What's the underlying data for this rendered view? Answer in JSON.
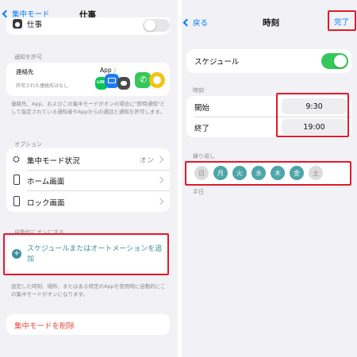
{
  "left": {
    "nav": {
      "back_label": "集中モード",
      "title": "仕事"
    },
    "top_row_label": "仕事",
    "notifications": {
      "section_caption": "通知を許可",
      "people_label": "連絡先",
      "people_sub": "許可された連絡先はなし",
      "apps_label": "App",
      "footnote": "連絡先、App、およびこの集中モードがオンの場合に\"即時通知\"として指定されている通知者やAppからの通話と通知を許可します。"
    },
    "options": {
      "section_caption": "オプション",
      "items": [
        {
          "label": "集中モード状況",
          "value": "オン"
        },
        {
          "label": "ホーム画面",
          "value": ""
        },
        {
          "label": "ロック画面",
          "value": ""
        }
      ]
    },
    "auto": {
      "section_caption": "自動的にオンにする",
      "add_label": "スケジュールまたはオートメーションを追加",
      "footnote": "設定した時刻、場所、またはある特定のAppを使用時に自動的にこの集中モードがオンになります。"
    },
    "delete_label": "集中モードを削除"
  },
  "right": {
    "nav": {
      "back_label": "戻る",
      "title": "時刻",
      "done_label": "完了"
    },
    "schedule_label": "スケジュール",
    "schedule_on": true,
    "time": {
      "section_caption": "時刻",
      "start_label": "開始",
      "start_value": "9:30",
      "end_label": "終了",
      "end_value": "19:00"
    },
    "repeat": {
      "section_caption": "繰り返し",
      "days": [
        {
          "label": "日",
          "on": false
        },
        {
          "label": "月",
          "on": true
        },
        {
          "label": "火",
          "on": true
        },
        {
          "label": "水",
          "on": true
        },
        {
          "label": "木",
          "on": true
        },
        {
          "label": "金",
          "on": true
        },
        {
          "label": "土",
          "on": false
        }
      ],
      "summary": "平日"
    }
  },
  "colors": {
    "accent": "#007aff",
    "toggle_on": "#34c759",
    "highlight": "#e21a2a",
    "day_on": "#4da5a8",
    "delete": "#e5483c"
  }
}
